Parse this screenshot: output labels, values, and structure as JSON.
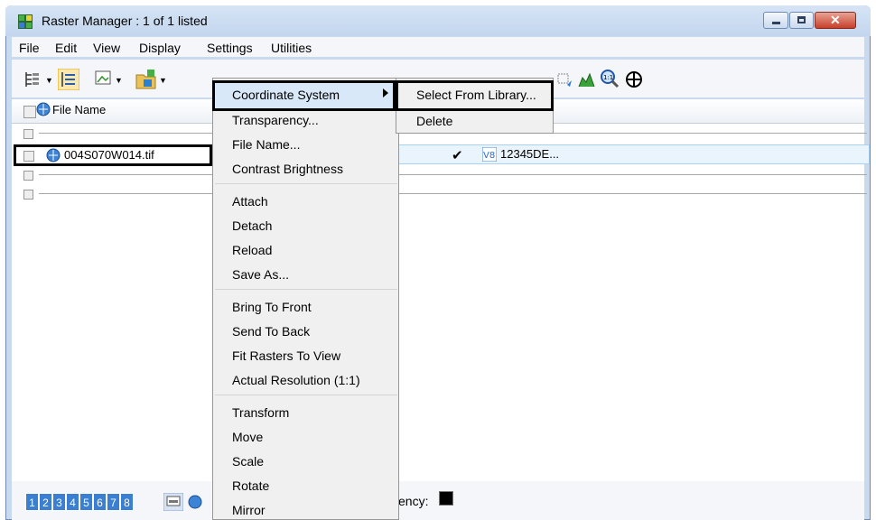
{
  "window": {
    "title": "Raster Manager : 1 of 1 listed"
  },
  "menubar": [
    "File",
    "Edit",
    "View",
    "Display",
    "Settings",
    "Utilities"
  ],
  "header": {
    "file_name": "File Name"
  },
  "row": {
    "file_name": "004S070W014.tif",
    "check": "✔",
    "coordinate_system": "12345DE..."
  },
  "context_menu": {
    "coordinate_system": "Coordinate System",
    "transparency": "Transparency...",
    "file_name": "File Name...",
    "contrast_brightness": "Contrast Brightness",
    "attach": "Attach",
    "detach": "Detach",
    "reload": "Reload",
    "save_as": "Save As...",
    "bring_to_front": "Bring To Front",
    "send_to_back": "Send To Back",
    "fit_rasters": "Fit Rasters To View",
    "actual_resolution": "Actual Resolution (1:1)",
    "transform": "Transform",
    "move": "Move",
    "scale": "Scale",
    "rotate": "Rotate",
    "mirror": "Mirror"
  },
  "submenu": {
    "select_from_library": "Select From Library...",
    "delete": "Delete"
  },
  "bottombar": {
    "views": [
      "1",
      "2",
      "3",
      "4",
      "5",
      "6",
      "7",
      "8"
    ],
    "transparency_label": "ency:"
  },
  "colors": {
    "accent": "#3a7fd1",
    "selection": "#d9e8f8"
  }
}
